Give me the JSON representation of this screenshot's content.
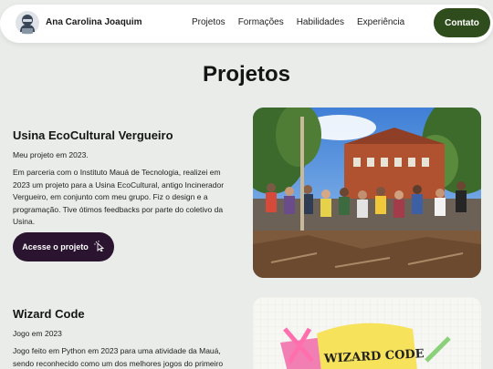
{
  "header": {
    "name": "Ana Carolina Joaquim",
    "nav": [
      "Projetos",
      "Formações",
      "Habilidades",
      "Experiência"
    ],
    "contact": "Contato"
  },
  "section": {
    "title": "Projetos"
  },
  "projects": [
    {
      "title": "Usina EcoCultural Vergueiro",
      "subtitle": "Meu projeto em 2023.",
      "description": "Em parceria com o Instituto Mauá de Tecnologia, realizei em 2023 um projeto para a Usina EcoCultural, antigo Incinerador Vergueiro, em conjunto com meu grupo. Fiz o design e a programação. Tive ótimos feedbacks por parte do coletivo da Usina.",
      "button": "Acesse o projeto"
    },
    {
      "title": "Wizard Code",
      "subtitle": "Jogo em 2023",
      "description": "Jogo feito em Python em 2023 para uma atividade da Mauá, sendo reconhecido como um dos melhores jogos do primeiro",
      "image_text": "WIZARD CODE"
    }
  ],
  "colors": {
    "contact_button": "#2f4d1c",
    "access_button": "#2a1430",
    "background": "#e9ece9"
  }
}
